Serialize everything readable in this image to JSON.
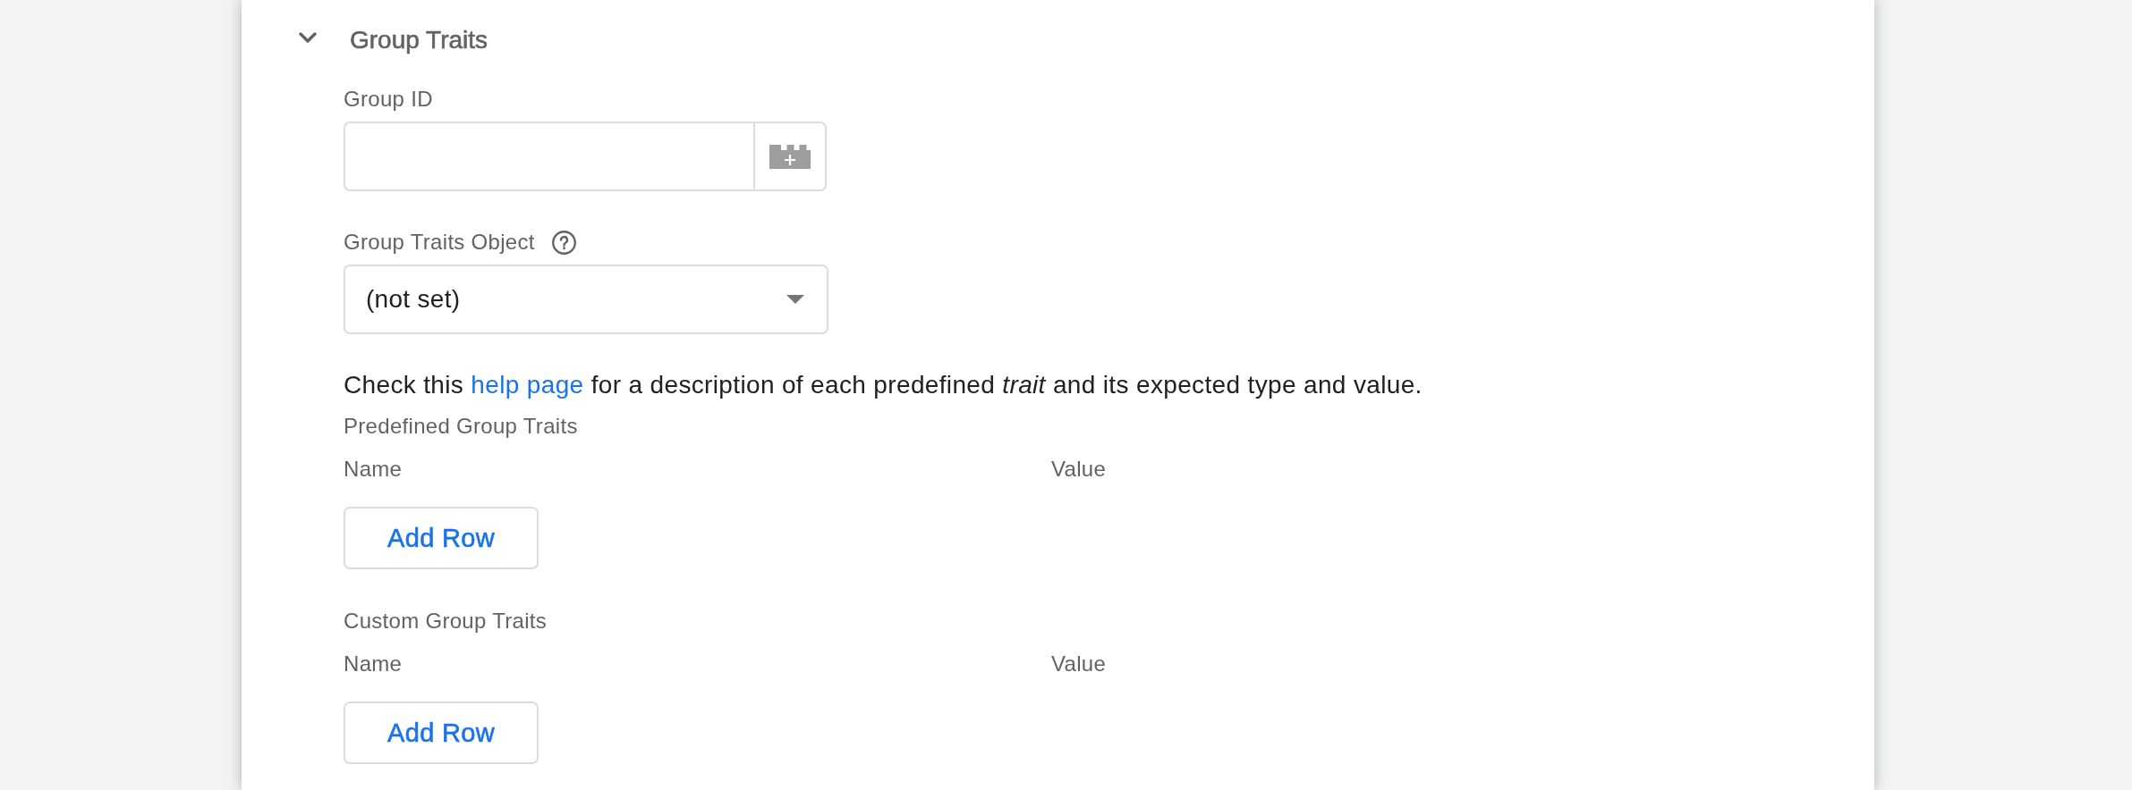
{
  "section": {
    "title": "Group Traits",
    "expanded": true
  },
  "fields": [
    {
      "kind": "text_with_picker",
      "label": "Group ID"
    },
    {
      "kind": "dropdown",
      "label": "Group Traits Object",
      "help_icon": true,
      "value": "(not set)"
    }
  ],
  "help_text": {
    "before": "Check this ",
    "link": "help page",
    "after": " for a description of each predefined *trait* and its expected type and value."
  },
  "tables": [
    {
      "title": "Predefined Group Traits",
      "columns": [
        "Name",
        "Value"
      ],
      "button": "Add Row"
    },
    {
      "title": "Custom Group Traits",
      "columns": [
        "Name",
        "Value"
      ],
      "button": "Add Row"
    }
  ]
}
